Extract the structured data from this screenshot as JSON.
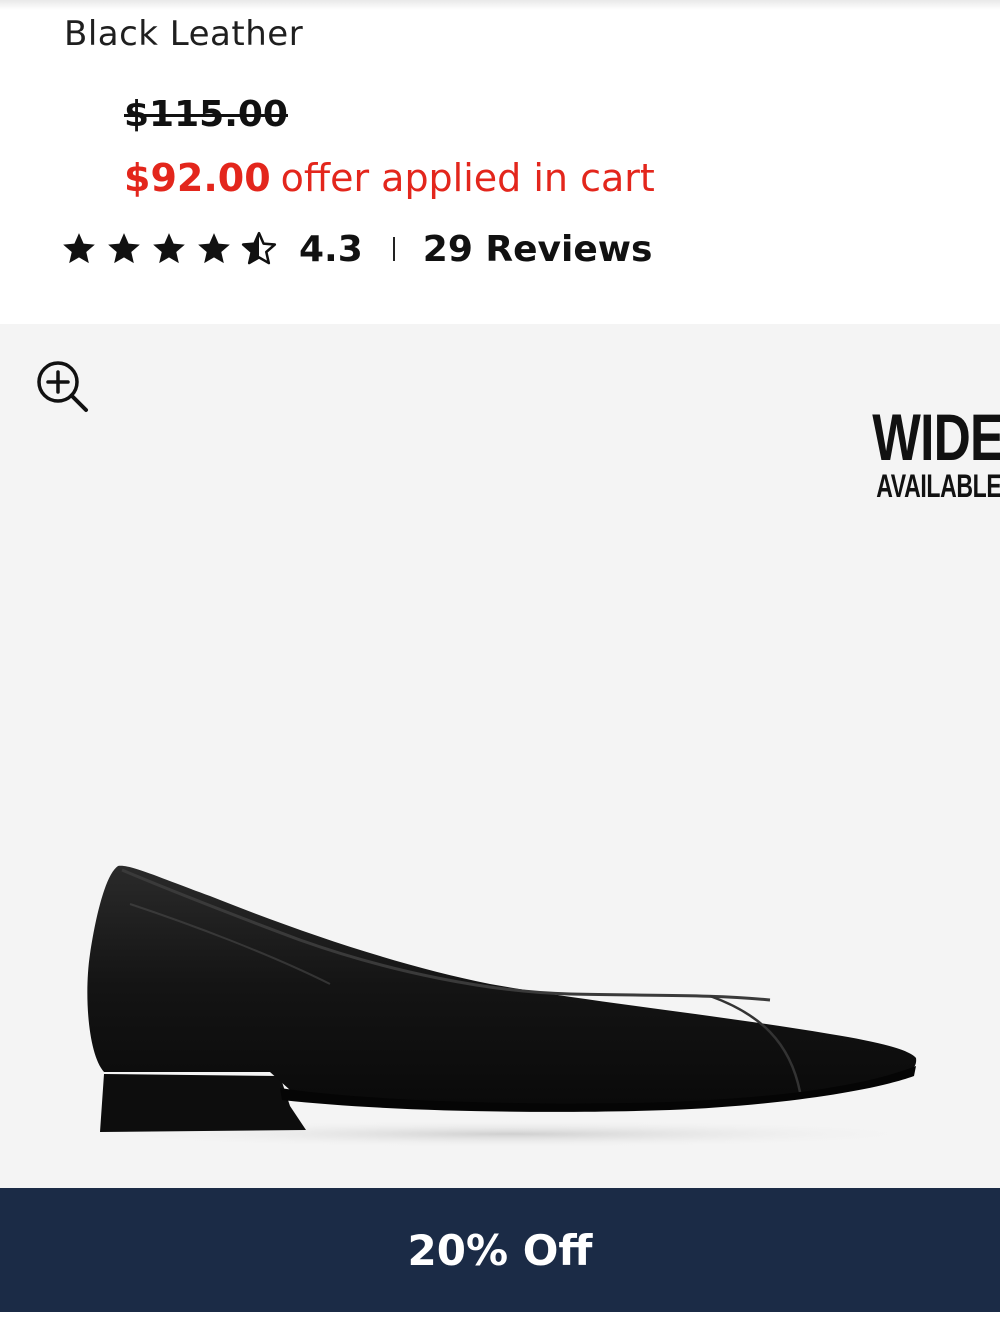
{
  "product": {
    "color_name": "Black Leather",
    "was_price": "$115.00",
    "now_price": "$92.00",
    "offer_text": "offer applied in cart",
    "rating_value": "4.3",
    "rating_stars": 4.3,
    "reviews_text": "29 Reviews"
  },
  "gallery": {
    "zoom_icon": "zoom-in-icon",
    "badge_line1": "WIDE",
    "badge_line2": "AVAILABLE"
  },
  "promo": {
    "label": "20% Off",
    "background": "#1b2b46"
  },
  "colors": {
    "price_red": "#e3261c",
    "gallery_bg": "#f4f4f4"
  }
}
